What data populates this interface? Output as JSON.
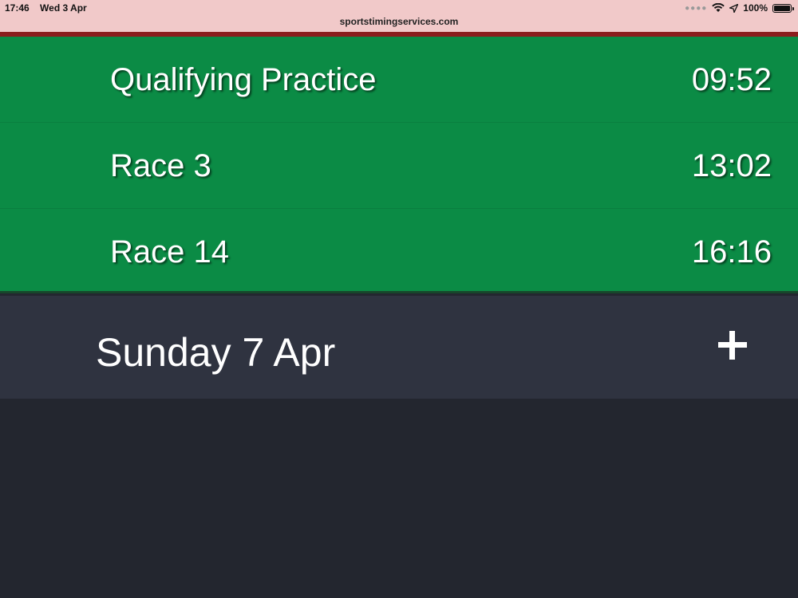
{
  "status_bar": {
    "time": "17:46",
    "date": "Wed 3 Apr",
    "url": "sportstimingservices.com",
    "battery_text": "100%",
    "battery_level": 1.0,
    "icons": [
      "signal-dots-icon",
      "wifi-icon",
      "location-arrow-icon",
      "battery-icon"
    ]
  },
  "colors": {
    "session_bg": "#0b8b45",
    "day_bg": "#2f3340",
    "page_bg": "#23262f",
    "status_bg": "#f1c9c9",
    "accent_line": "#8b1d1d"
  },
  "sessions": [
    {
      "name": "Qualifying Practice",
      "time": "09:52"
    },
    {
      "name": "Race 3",
      "time": "13:02"
    },
    {
      "name": "Race 14",
      "time": "16:16"
    }
  ],
  "day_group": {
    "label": "Sunday 7 Apr",
    "expand_icon": "plus-icon"
  }
}
